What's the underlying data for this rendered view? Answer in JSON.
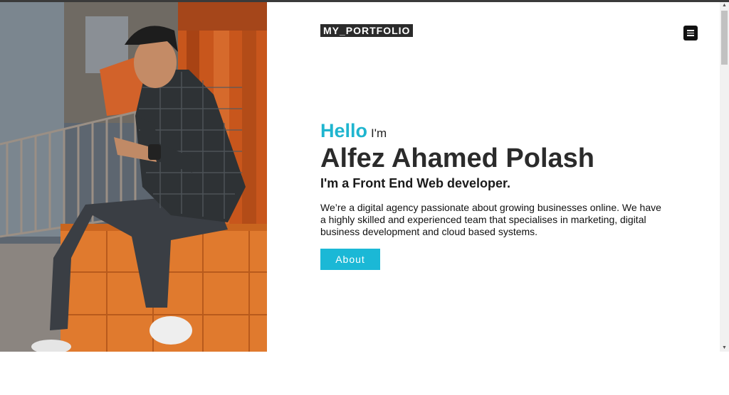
{
  "header": {
    "logo_text": "MY_PORTFOLIO",
    "menu_icon": "hamburger-menu-icon"
  },
  "hero": {
    "greeting": "Hello",
    "greeting_suffix": "I'm",
    "name": "Alfez Ahamed Polash",
    "role": "I'm a Front End Web developer.",
    "description": "We’re a digital agency passionate about growing businesses online. We have a highly skilled and experienced team that specialises in marketing, digital business development and cloud based systems.",
    "button_label": "About"
  },
  "photo": {
    "subject": "person sitting on orange tiled ledge looking at phone"
  },
  "scrollbar": {
    "up_arrow": "▲",
    "down_arrow": "▼"
  },
  "colors": {
    "accent": "#1bb8d6",
    "logo_bg": "#2b2b2b",
    "heading": "#2b2b2b"
  }
}
